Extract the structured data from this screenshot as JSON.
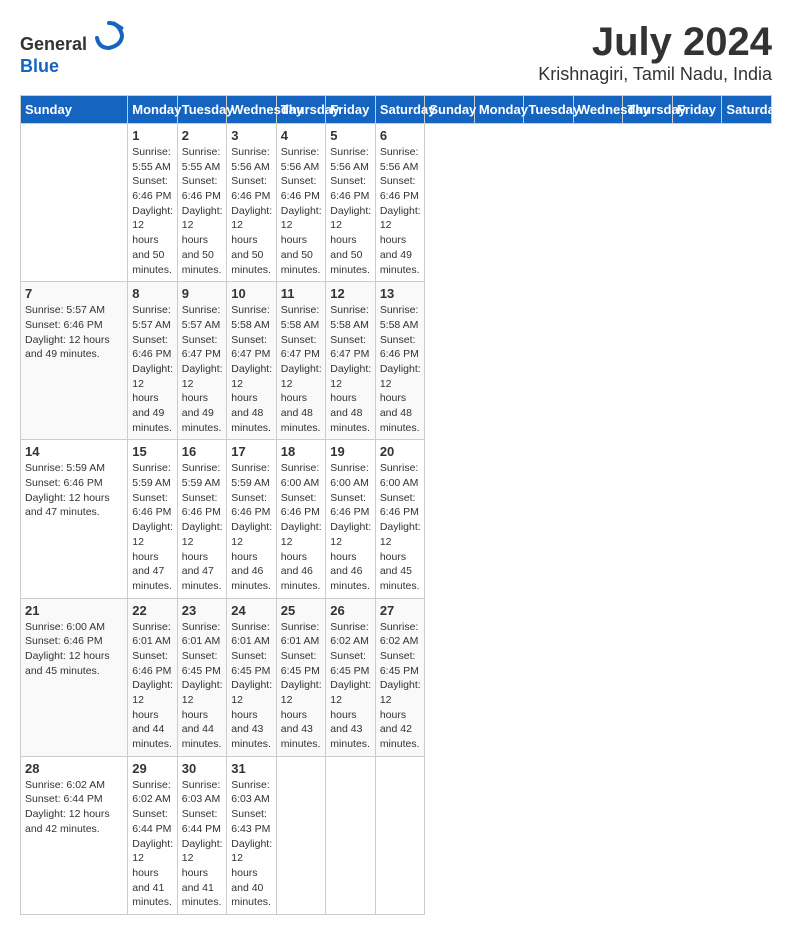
{
  "header": {
    "logo_line1": "General",
    "logo_line2": "Blue",
    "month": "July 2024",
    "location": "Krishnagiri, Tamil Nadu, India"
  },
  "days_of_week": [
    "Sunday",
    "Monday",
    "Tuesday",
    "Wednesday",
    "Thursday",
    "Friday",
    "Saturday"
  ],
  "weeks": [
    [
      {
        "day": "",
        "detail": ""
      },
      {
        "day": "1",
        "detail": "Sunrise: 5:55 AM\nSunset: 6:46 PM\nDaylight: 12 hours\nand 50 minutes."
      },
      {
        "day": "2",
        "detail": "Sunrise: 5:55 AM\nSunset: 6:46 PM\nDaylight: 12 hours\nand 50 minutes."
      },
      {
        "day": "3",
        "detail": "Sunrise: 5:56 AM\nSunset: 6:46 PM\nDaylight: 12 hours\nand 50 minutes."
      },
      {
        "day": "4",
        "detail": "Sunrise: 5:56 AM\nSunset: 6:46 PM\nDaylight: 12 hours\nand 50 minutes."
      },
      {
        "day": "5",
        "detail": "Sunrise: 5:56 AM\nSunset: 6:46 PM\nDaylight: 12 hours\nand 50 minutes."
      },
      {
        "day": "6",
        "detail": "Sunrise: 5:56 AM\nSunset: 6:46 PM\nDaylight: 12 hours\nand 49 minutes."
      }
    ],
    [
      {
        "day": "7",
        "detail": "Sunrise: 5:57 AM\nSunset: 6:46 PM\nDaylight: 12 hours\nand 49 minutes."
      },
      {
        "day": "8",
        "detail": "Sunrise: 5:57 AM\nSunset: 6:46 PM\nDaylight: 12 hours\nand 49 minutes."
      },
      {
        "day": "9",
        "detail": "Sunrise: 5:57 AM\nSunset: 6:47 PM\nDaylight: 12 hours\nand 49 minutes."
      },
      {
        "day": "10",
        "detail": "Sunrise: 5:58 AM\nSunset: 6:47 PM\nDaylight: 12 hours\nand 48 minutes."
      },
      {
        "day": "11",
        "detail": "Sunrise: 5:58 AM\nSunset: 6:47 PM\nDaylight: 12 hours\nand 48 minutes."
      },
      {
        "day": "12",
        "detail": "Sunrise: 5:58 AM\nSunset: 6:47 PM\nDaylight: 12 hours\nand 48 minutes."
      },
      {
        "day": "13",
        "detail": "Sunrise: 5:58 AM\nSunset: 6:46 PM\nDaylight: 12 hours\nand 48 minutes."
      }
    ],
    [
      {
        "day": "14",
        "detail": "Sunrise: 5:59 AM\nSunset: 6:46 PM\nDaylight: 12 hours\nand 47 minutes."
      },
      {
        "day": "15",
        "detail": "Sunrise: 5:59 AM\nSunset: 6:46 PM\nDaylight: 12 hours\nand 47 minutes."
      },
      {
        "day": "16",
        "detail": "Sunrise: 5:59 AM\nSunset: 6:46 PM\nDaylight: 12 hours\nand 47 minutes."
      },
      {
        "day": "17",
        "detail": "Sunrise: 5:59 AM\nSunset: 6:46 PM\nDaylight: 12 hours\nand 46 minutes."
      },
      {
        "day": "18",
        "detail": "Sunrise: 6:00 AM\nSunset: 6:46 PM\nDaylight: 12 hours\nand 46 minutes."
      },
      {
        "day": "19",
        "detail": "Sunrise: 6:00 AM\nSunset: 6:46 PM\nDaylight: 12 hours\nand 46 minutes."
      },
      {
        "day": "20",
        "detail": "Sunrise: 6:00 AM\nSunset: 6:46 PM\nDaylight: 12 hours\nand 45 minutes."
      }
    ],
    [
      {
        "day": "21",
        "detail": "Sunrise: 6:00 AM\nSunset: 6:46 PM\nDaylight: 12 hours\nand 45 minutes."
      },
      {
        "day": "22",
        "detail": "Sunrise: 6:01 AM\nSunset: 6:46 PM\nDaylight: 12 hours\nand 44 minutes."
      },
      {
        "day": "23",
        "detail": "Sunrise: 6:01 AM\nSunset: 6:45 PM\nDaylight: 12 hours\nand 44 minutes."
      },
      {
        "day": "24",
        "detail": "Sunrise: 6:01 AM\nSunset: 6:45 PM\nDaylight: 12 hours\nand 43 minutes."
      },
      {
        "day": "25",
        "detail": "Sunrise: 6:01 AM\nSunset: 6:45 PM\nDaylight: 12 hours\nand 43 minutes."
      },
      {
        "day": "26",
        "detail": "Sunrise: 6:02 AM\nSunset: 6:45 PM\nDaylight: 12 hours\nand 43 minutes."
      },
      {
        "day": "27",
        "detail": "Sunrise: 6:02 AM\nSunset: 6:45 PM\nDaylight: 12 hours\nand 42 minutes."
      }
    ],
    [
      {
        "day": "28",
        "detail": "Sunrise: 6:02 AM\nSunset: 6:44 PM\nDaylight: 12 hours\nand 42 minutes."
      },
      {
        "day": "29",
        "detail": "Sunrise: 6:02 AM\nSunset: 6:44 PM\nDaylight: 12 hours\nand 41 minutes."
      },
      {
        "day": "30",
        "detail": "Sunrise: 6:03 AM\nSunset: 6:44 PM\nDaylight: 12 hours\nand 41 minutes."
      },
      {
        "day": "31",
        "detail": "Sunrise: 6:03 AM\nSunset: 6:43 PM\nDaylight: 12 hours\nand 40 minutes."
      },
      {
        "day": "",
        "detail": ""
      },
      {
        "day": "",
        "detail": ""
      },
      {
        "day": "",
        "detail": ""
      }
    ]
  ]
}
